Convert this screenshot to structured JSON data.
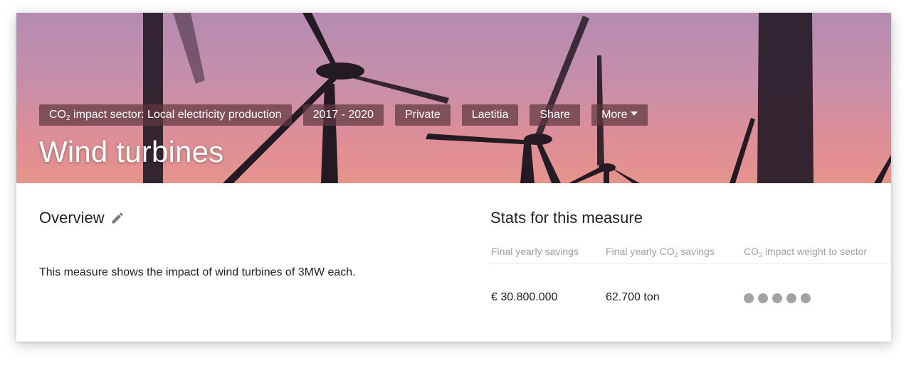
{
  "hero": {
    "tags": {
      "sector_prefix": "CO",
      "sector_sub": "2",
      "sector_suffix": " impact sector: Local electricity production",
      "period": "2017 - 2020",
      "visibility": "Private",
      "owner": "Laetitia",
      "share": "Share",
      "more": "More"
    },
    "title": "Wind turbines"
  },
  "overview": {
    "title": "Overview",
    "description": "This measure shows the impact of wind turbines of 3MW each."
  },
  "stats": {
    "title": "Stats for this measure",
    "columns": {
      "savings_label": "Final yearly savings",
      "co2_label_prefix": "Final yearly CO",
      "co2_label_sub": "2",
      "co2_label_suffix": " savings",
      "weight_label_prefix": "CO",
      "weight_label_sub": "2",
      "weight_label_suffix": " impact weight to sector"
    },
    "values": {
      "savings": "€ 30.800.000",
      "co2_savings": "62.700 ton",
      "weight_level": 5,
      "weight_max": 5
    }
  },
  "colors": {
    "tag_bg": "#5f3741",
    "dot_color": "#a3a3a3",
    "muted_text": "#a0a0a0"
  }
}
